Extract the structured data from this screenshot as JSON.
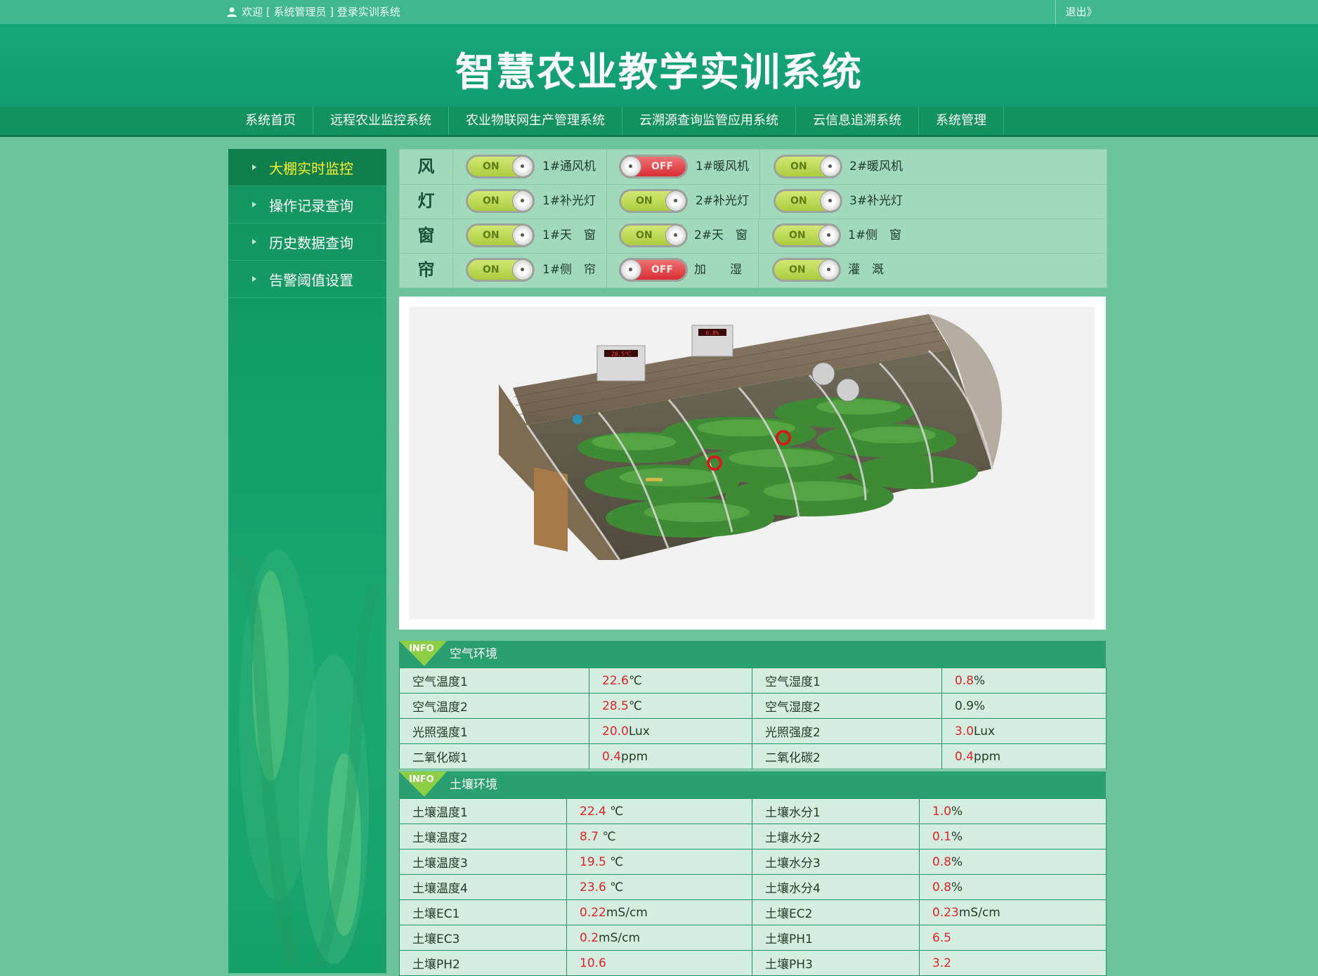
{
  "topbar": {
    "welcome": "欢迎 [ 系统管理员 ] 登录实训系统",
    "logout": "退出》"
  },
  "banner": {
    "title": "智慧农业教学实训系统"
  },
  "nav": [
    "系统首页",
    "远程农业监控系统",
    "农业物联网生产管理系统",
    "云溯源查询监管应用系统",
    "云信息追溯系统",
    "系统管理"
  ],
  "sidebar": [
    {
      "label": "大棚实时监控",
      "active": true
    },
    {
      "label": "操作记录查询",
      "active": false
    },
    {
      "label": "历史数据查询",
      "active": false
    },
    {
      "label": "告警阈值设置",
      "active": false
    }
  ],
  "controls": [
    {
      "category": "风",
      "devices": [
        {
          "state": "ON",
          "name": "1#通风机"
        },
        {
          "state": "OFF",
          "name": "1#暖风机"
        },
        {
          "state": "ON",
          "name": "2#暖风机"
        }
      ]
    },
    {
      "category": "灯",
      "devices": [
        {
          "state": "ON",
          "name": "1#补光灯"
        },
        {
          "state": "ON",
          "name": "2#补光灯"
        },
        {
          "state": "ON",
          "name": "3#补光灯"
        }
      ]
    },
    {
      "category": "窗",
      "devices": [
        {
          "state": "ON",
          "name": "1#天　窗"
        },
        {
          "state": "ON",
          "name": "2#天　窗"
        },
        {
          "state": "ON",
          "name": "1#侧　窗"
        }
      ]
    },
    {
      "category": "帘",
      "devices": [
        {
          "state": "ON",
          "name": "1#侧　帘"
        },
        {
          "state": "OFF",
          "name": "加　　湿"
        },
        {
          "state": "ON",
          "name": "灌　溉"
        }
      ]
    }
  ],
  "air": {
    "tag": "INFO",
    "title": "空气环境",
    "rows": [
      [
        {
          "label": "空气温度1",
          "value": "22.6",
          "unit": "℃"
        },
        {
          "label": "空气湿度1",
          "value": "0.8",
          "unit": "%"
        }
      ],
      [
        {
          "label": "空气温度2",
          "value": "28.5",
          "unit": "℃"
        },
        {
          "label": "空气湿度2",
          "value": "",
          "unit": "0.9%"
        }
      ],
      [
        {
          "label": "光照强度1",
          "value": "20.0",
          "unit": "Lux"
        },
        {
          "label": "光照强度2",
          "value": "3.0",
          "unit": "Lux"
        }
      ],
      [
        {
          "label": "二氧化碳1",
          "value": "0.4",
          "unit": "ppm"
        },
        {
          "label": "二氧化碳2",
          "value": "0.4",
          "unit": "ppm"
        }
      ]
    ]
  },
  "soil": {
    "tag": "INFO",
    "title": "土壤环境",
    "rows": [
      [
        {
          "label": "土壤温度1",
          "value": "22.4",
          "unit": " ℃"
        },
        {
          "label": "土壤水分1",
          "value": "1.0",
          "unit": "%"
        }
      ],
      [
        {
          "label": "土壤温度2",
          "value": "8.7",
          "unit": " ℃"
        },
        {
          "label": "土壤水分2",
          "value": "0.1",
          "unit": "%"
        }
      ],
      [
        {
          "label": "土壤温度3",
          "value": "19.5",
          "unit": " ℃"
        },
        {
          "label": "土壤水分3",
          "value": "0.8",
          "unit": "%"
        }
      ],
      [
        {
          "label": "土壤温度4",
          "value": "23.6",
          "unit": " ℃"
        },
        {
          "label": "土壤水分4",
          "value": "0.8",
          "unit": "%"
        }
      ],
      [
        {
          "label": "土壤EC1",
          "value": "0.22",
          "unit": "mS/cm"
        },
        {
          "label": "土壤EC2",
          "value": "0.23",
          "unit": "mS/cm"
        }
      ],
      [
        {
          "label": "土壤EC3",
          "value": "0.2",
          "unit": "mS/cm"
        },
        {
          "label": "土壤PH1",
          "value": "6.5",
          "unit": ""
        }
      ],
      [
        {
          "label": "土壤PH2",
          "value": "10.6",
          "unit": ""
        },
        {
          "label": "土壤PH3",
          "value": "3.2",
          "unit": ""
        }
      ]
    ]
  },
  "greenhouse": {
    "display1": "28.5℃",
    "display2": "0.8%"
  },
  "colors": {
    "accent": "#16a77b",
    "on": "#a8c93a",
    "off": "#d8252b",
    "value": "#e02424"
  }
}
